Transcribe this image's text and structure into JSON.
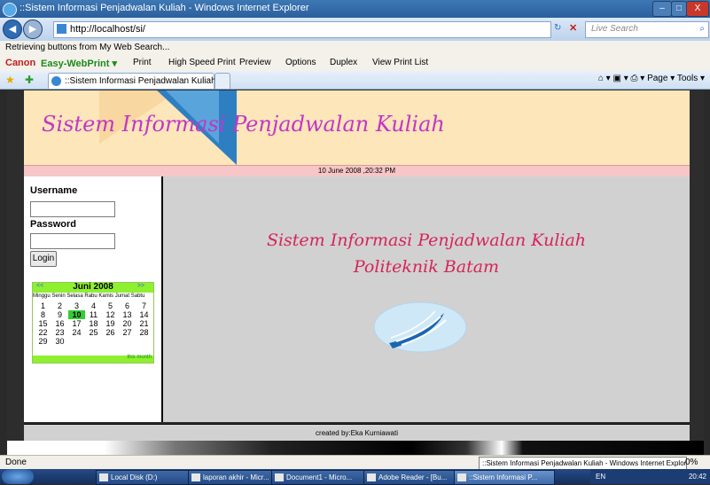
{
  "window": {
    "title": "::Sistem Informasi Penjadwalan Kuliah - Windows Internet Explorer",
    "controls": [
      "–",
      "□",
      "X"
    ]
  },
  "addressbar": {
    "url": "http://localhost/si/",
    "search_placeholder": "Live Search"
  },
  "infobar": {
    "text": "Retrieving buttons from My Web Search..."
  },
  "canon": {
    "brand": "Canon",
    "product": "Easy-WebPrint ▾",
    "items": [
      "Print",
      "High Speed Print",
      "Preview",
      "Options",
      "Duplex",
      "View Print List"
    ]
  },
  "tabs": {
    "active_tab": "::Sistem Informasi Penjadwalan Kuliah"
  },
  "commandbar": {
    "page": "Page ▾",
    "tools": "Tools ▾"
  },
  "site": {
    "title": "Sistem Informasi Penjadwalan Kuliah",
    "date": "10 June 2008 ,20:32 PM",
    "main_line1": "Sistem Informasi Penjadwalan Kuliah",
    "main_line2": "Politeknik Batam",
    "footer": "created by:Eka Kurniawati"
  },
  "login": {
    "username_label": "Username",
    "password_label": "Password",
    "button": "Login",
    "username_value": "",
    "password_value": ""
  },
  "calendar": {
    "month": "Juni 2008",
    "prev": "<<",
    "next": ">>",
    "day_headers": "Minggu Senin Selasa Rabu Kamis Jumat Sabtu",
    "rows": [
      [
        "1",
        "2",
        "3",
        "4",
        "5",
        "6",
        "7"
      ],
      [
        "8",
        "9",
        "10",
        "11",
        "12",
        "13",
        "14"
      ],
      [
        "15",
        "16",
        "17",
        "18",
        "19",
        "20",
        "21"
      ],
      [
        "22",
        "23",
        "24",
        "25",
        "26",
        "27",
        "28"
      ],
      [
        "29",
        "30",
        "",
        "",
        "",
        "",
        ""
      ]
    ],
    "today": "10",
    "footer_link": "this month"
  },
  "statusbar": {
    "text": "Done",
    "tooltip": "::Sistem Informasi Penjadwalan Kuliah - Windows Internet Explorer",
    "progress": "0%"
  },
  "taskbar": {
    "items": [
      "Local Disk (D:)",
      "laporan akhir - Micr...",
      "Document1 - Micro...",
      "Adobe Reader - [Bu...",
      "::Sistem Informasi P..."
    ],
    "lang": "EN",
    "clock": "20:42"
  },
  "colors": {
    "title_text": "#c236c8",
    "main_text": "#d6245a",
    "calendar_header": "#8ff02f",
    "today_cell": "#33cc33"
  }
}
